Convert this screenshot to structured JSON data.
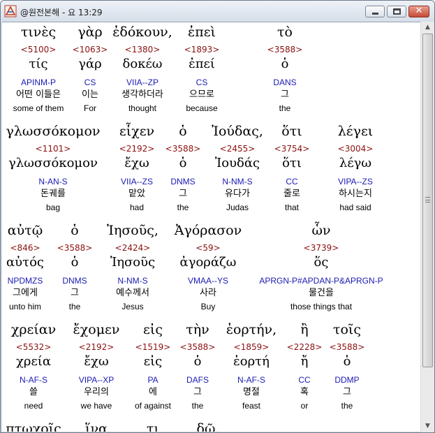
{
  "window": {
    "title": "@원전본해 - 요 13:29"
  },
  "rows": [
    {
      "words": [
        {
          "greek": "τινὲς",
          "strong": "<5100>",
          "lemma": "τίς",
          "parse": "APINM-P",
          "korean": "어떤 이들은",
          "english": "some of them"
        },
        {
          "greek": "γὰρ",
          "strong": "<1063>",
          "lemma": "γάρ",
          "parse": "CS",
          "korean": "이는",
          "english": "For"
        },
        {
          "greek": "ἐδόκουν,",
          "strong": "<1380>",
          "lemma": "δοκέω",
          "parse": "VIIA--ZP",
          "korean": "생각하더라",
          "english": "thought"
        },
        {
          "greek": "ἐπεὶ",
          "strong": "<1893>",
          "lemma": "ἐπεί",
          "parse": "CS",
          "korean": "으므로",
          "english": "because"
        },
        {
          "greek": "τὸ",
          "strong": "<3588>",
          "lemma": "ὁ",
          "parse": "DANS",
          "korean": "그",
          "english": "the"
        }
      ]
    },
    {
      "words": [
        {
          "greek": "γλωσσόκομον",
          "strong": "<1101>",
          "lemma": "γλωσσόκομον",
          "parse": "N-AN-S",
          "korean": "돈궤를",
          "english": "bag"
        },
        {
          "greek": "εἶχεν",
          "strong": "<2192>",
          "lemma": "ἔχω",
          "parse": "VIIA--ZS",
          "korean": "맡았",
          "english": "had"
        },
        {
          "greek": "ὁ",
          "strong": "<3588>",
          "lemma": "ὁ",
          "parse": "DNMS",
          "korean": "그",
          "english": "the"
        },
        {
          "greek": "Ἰούδας,",
          "strong": "<2455>",
          "lemma": "Ἰουδάς",
          "parse": "N-NM-S",
          "korean": "유다가",
          "english": "Judas"
        },
        {
          "greek": "ὅτι",
          "strong": "<3754>",
          "lemma": "ὅτι",
          "parse": "CC",
          "korean": "줄로",
          "english": "that"
        },
        {
          "greek": "λέγει",
          "strong": "<3004>",
          "lemma": "λέγω",
          "parse": "VIPA--ZS",
          "korean": "하시는지",
          "english": "had said"
        }
      ]
    },
    {
      "words": [
        {
          "greek": "αὐτῷ",
          "strong": "<846>",
          "lemma": "αὐτός",
          "parse": "NPDMZS",
          "korean": "그에게",
          "english": "unto him"
        },
        {
          "greek": "ὁ",
          "strong": "<3588>",
          "lemma": "ὁ",
          "parse": "DNMS",
          "korean": "그",
          "english": "the"
        },
        {
          "greek": "Ἰησοῦς,",
          "strong": "<2424>",
          "lemma": "Ἰησοῦς",
          "parse": "N-NM-S",
          "korean": "예수께서",
          "english": "Jesus"
        },
        {
          "greek": "Ἀγόρασον",
          "strong": "<59>",
          "lemma": "ἀγοράζω",
          "parse": "VMAA--YS",
          "korean": "사라",
          "english": "Buy"
        },
        {
          "greek": "ὧν",
          "strong": "<3739>",
          "lemma": "ὅς",
          "parse": "APRGN-P#APDAN-P&APRGN-P",
          "korean": "물건을",
          "english": "those things that"
        }
      ]
    },
    {
      "words": [
        {
          "greek": "χρείαν",
          "strong": "<5532>",
          "lemma": "χρεία",
          "parse": "N-AF-S",
          "korean": "쓸",
          "english": "need"
        },
        {
          "greek": "ἔχομεν",
          "strong": "<2192>",
          "lemma": "ἔχω",
          "parse": "VIPA--XP",
          "korean": "우리의",
          "english": "we have"
        },
        {
          "greek": "εἰς",
          "strong": "<1519>",
          "lemma": "εἰς",
          "parse": "PA",
          "korean": "에",
          "english": "of against"
        },
        {
          "greek": "τὴν",
          "strong": "<3588>",
          "lemma": "ὁ",
          "parse": "DAFS",
          "korean": "그",
          "english": "the"
        },
        {
          "greek": "ἑορτήν,",
          "strong": "<1859>",
          "lemma": "ἑορτή",
          "parse": "N-AF-S",
          "korean": "명절",
          "english": "feast"
        },
        {
          "greek": "ἢ",
          "strong": "<2228>",
          "lemma": "ἤ",
          "parse": "CC",
          "korean": "혹",
          "english": "or"
        },
        {
          "greek": "τοῖς",
          "strong": "<3588>",
          "lemma": "ὁ",
          "parse": "DDMP",
          "korean": "그",
          "english": "the"
        }
      ]
    },
    {
      "words": [
        {
          "greek": "πτωχοῖς",
          "strong": "",
          "lemma": "",
          "parse": "",
          "korean": "",
          "english": ""
        },
        {
          "greek": "ἵνα",
          "strong": "",
          "lemma": "",
          "parse": "",
          "korean": "",
          "english": ""
        },
        {
          "greek": "τι",
          "strong": "",
          "lemma": "",
          "parse": "",
          "korean": "",
          "english": ""
        },
        {
          "greek": "δῷ.",
          "strong": "",
          "lemma": "",
          "parse": "",
          "korean": "",
          "english": ""
        }
      ]
    }
  ]
}
